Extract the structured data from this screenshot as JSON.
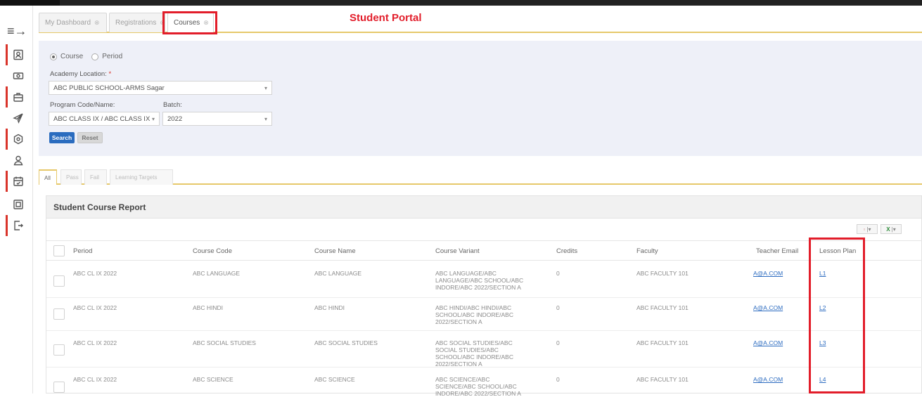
{
  "portal_title": "Student Portal",
  "tabs": [
    {
      "label": "My Dashboard",
      "active": false
    },
    {
      "label": "Registrations",
      "active": false
    },
    {
      "label": "Courses",
      "active": true
    }
  ],
  "filters": {
    "radio_course": "Course",
    "radio_period": "Period",
    "academy_label": "Academy Location:",
    "academy_required": "*",
    "academy_value": "ABC PUBLIC SCHOOL-ARMS Sagar",
    "program_label": "Program Code/Name:",
    "program_value": "ABC CLASS IX / ABC CLASS IX",
    "batch_label": "Batch:",
    "batch_value": "2022",
    "search_label": "Search",
    "reset_label": "Reset"
  },
  "subtabs": [
    "All",
    "Pass",
    "Fail",
    "Learning Targets"
  ],
  "report": {
    "title": "Student Course Report",
    "columns": [
      "Period",
      "Course Code",
      "Course Name",
      "Course Variant",
      "Credits",
      "Faculty",
      "Teacher Email",
      "Lesson Plan"
    ],
    "rows": [
      {
        "period": "ABC CL IX 2022",
        "code": "ABC LANGUAGE",
        "name": "ABC LANGUAGE",
        "variant": "ABC LANGUAGE/ABC LANGUAGE/ABC SCHOOL/ABC INDORE/ABC 2022/SECTION A",
        "credits": "0",
        "faculty": "ABC FACULTY 101",
        "email": "A@A.COM",
        "lesson": "L1"
      },
      {
        "period": "ABC CL IX 2022",
        "code": "ABC HINDI",
        "name": "ABC HINDI",
        "variant": "ABC HINDI/ABC HINDI/ABC SCHOOL/ABC INDORE/ABC 2022/SECTION A",
        "credits": "0",
        "faculty": "ABC FACULTY 101",
        "email": "A@A.COM",
        "lesson": "L2"
      },
      {
        "period": "ABC CL IX 2022",
        "code": "ABC SOCIAL STUDIES",
        "name": "ABC SOCIAL STUDIES",
        "variant": "ABC SOCIAL STUDIES/ABC SOCIAL STUDIES/ABC SCHOOL/ABC INDORE/ABC 2022/SECTION A",
        "credits": "0",
        "faculty": "ABC FACULTY 101",
        "email": "A@A.COM",
        "lesson": "L3"
      },
      {
        "period": "ABC CL IX 2022",
        "code": "ABC SCIENCE",
        "name": "ABC SCIENCE",
        "variant": "ABC SCIENCE/ABC SCIENCE/ABC SCHOOL/ABC INDORE/ABC 2022/SECTION A",
        "credits": "0",
        "faculty": "ABC FACULTY 101",
        "email": "A@A.COM",
        "lesson": "L4"
      }
    ]
  },
  "colors": {
    "highlight": "#e21d2a",
    "accent_underline": "#e6c86a",
    "search_button": "#2a6cbf",
    "link": "#2d6cc0"
  }
}
